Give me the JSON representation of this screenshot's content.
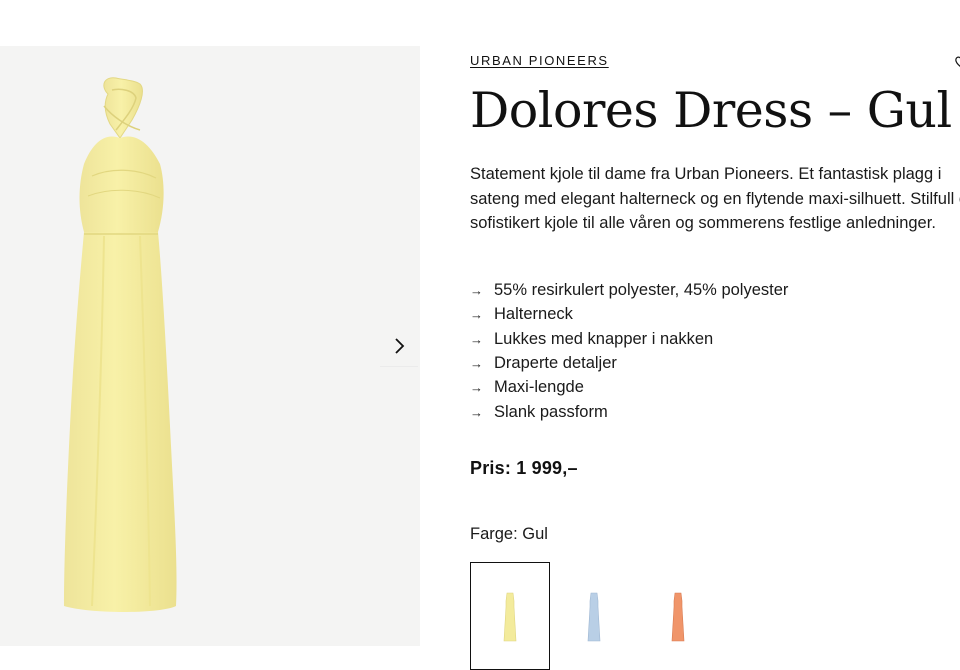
{
  "product": {
    "brand": "URBAN PIONEERS",
    "title": "Dolores Dress – Gul",
    "description": "Statement kjole til dame fra Urban Pioneers. Et fantastisk plagg i\nsateng med elegant halterneck og en flytende maxi-silhuett. Stilfull og\nsofistikert kjole til alle våren og sommerens festlige anledninger.",
    "features": [
      "55% resirkulert polyester, 45% polyester",
      "Halterneck",
      "Lukkes med knapper i nakken",
      "Draperte detaljer",
      "Maxi-lengde",
      "Slank passform"
    ],
    "feature_arrow": "→",
    "price": "Pris: 1 999,–",
    "color_label": "Farge: Gul"
  },
  "icons": {
    "gallery_next": "chevron-right-icon",
    "wishlist": "heart-icon"
  },
  "swatches": [
    {
      "name": "Gul",
      "color": "#f3eb9c",
      "selected": true
    },
    {
      "name": "Blå",
      "color": "#b9cfe6",
      "selected": false
    },
    {
      "name": "Oransje",
      "color": "#f0956a",
      "selected": false
    }
  ],
  "colors": {
    "dress_main": "#f6f0a4",
    "dress_shade": "#e9df86",
    "gallery_bg": "#f4f4f3"
  }
}
